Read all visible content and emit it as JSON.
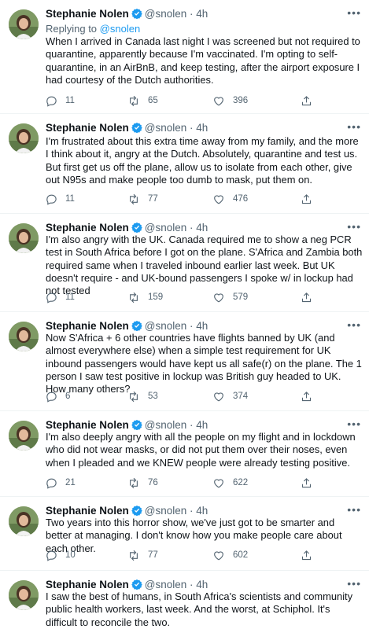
{
  "author": {
    "name": "Stephanie Nolen",
    "handle": "@snolen",
    "time": "4h"
  },
  "reply_prefix": "Replying to",
  "reply_handle": "@snolen",
  "tweets": [
    {
      "text": "When I arrived in Canada last night I was screened but not required to quarantine, apparently because I'm vaccinated. I'm opting to self-quarantine, in an AirBnB, and keep testing, after the airport exposure I had courtesy of the Dutch authorities.",
      "replies": "11",
      "retweets": "65",
      "likes": "396"
    },
    {
      "text": "I'm frustrated about this extra time away from my family, and the more I think about it, angry at the Dutch. Absolutely, quarantine and test us. But first get us off the plane, allow us to isolate from each other, give out N95s and make people too dumb to mask, put them on.",
      "replies": "11",
      "retweets": "77",
      "likes": "476"
    },
    {
      "text": "I'm also angry with the UK. Canada required me to show a neg PCR test in South Africa before I got on the plane. S'Africa and Zambia both required same when I traveled inbound earlier last week. But UK doesn't require - and UK-bound passengers I spoke w/ in lockup had not tested",
      "replies": "11",
      "retweets": "159",
      "likes": "579"
    },
    {
      "text": "Now S'Africa + 6 other countries have flights banned by UK (and almost everywhere else) when a simple test requirement for UK inbound passengers would have kept us all safe(r) on the plane. The 1 person I saw test positive in lockup was British guy headed to UK. How many others?",
      "replies": "6",
      "retweets": "53",
      "likes": "374"
    },
    {
      "text": "I'm also deeply angry with all the people on my flight and in lockdown who did not wear masks, or did not put them over their noses, even when I pleaded and we KNEW people were already testing positive.",
      "replies": "21",
      "retweets": "76",
      "likes": "622"
    },
    {
      "text": "Two years into this horror show, we've just got to be smarter and better at managing. I don't know how you make people care about each other.",
      "replies": "10",
      "retweets": "77",
      "likes": "602"
    },
    {
      "text": "I saw the best of humans, in South Africa's scientists and community public health workers, last week. And the worst, at Schiphol. It's difficult to reconcile the two.",
      "replies": "",
      "retweets": "",
      "likes": ""
    }
  ]
}
